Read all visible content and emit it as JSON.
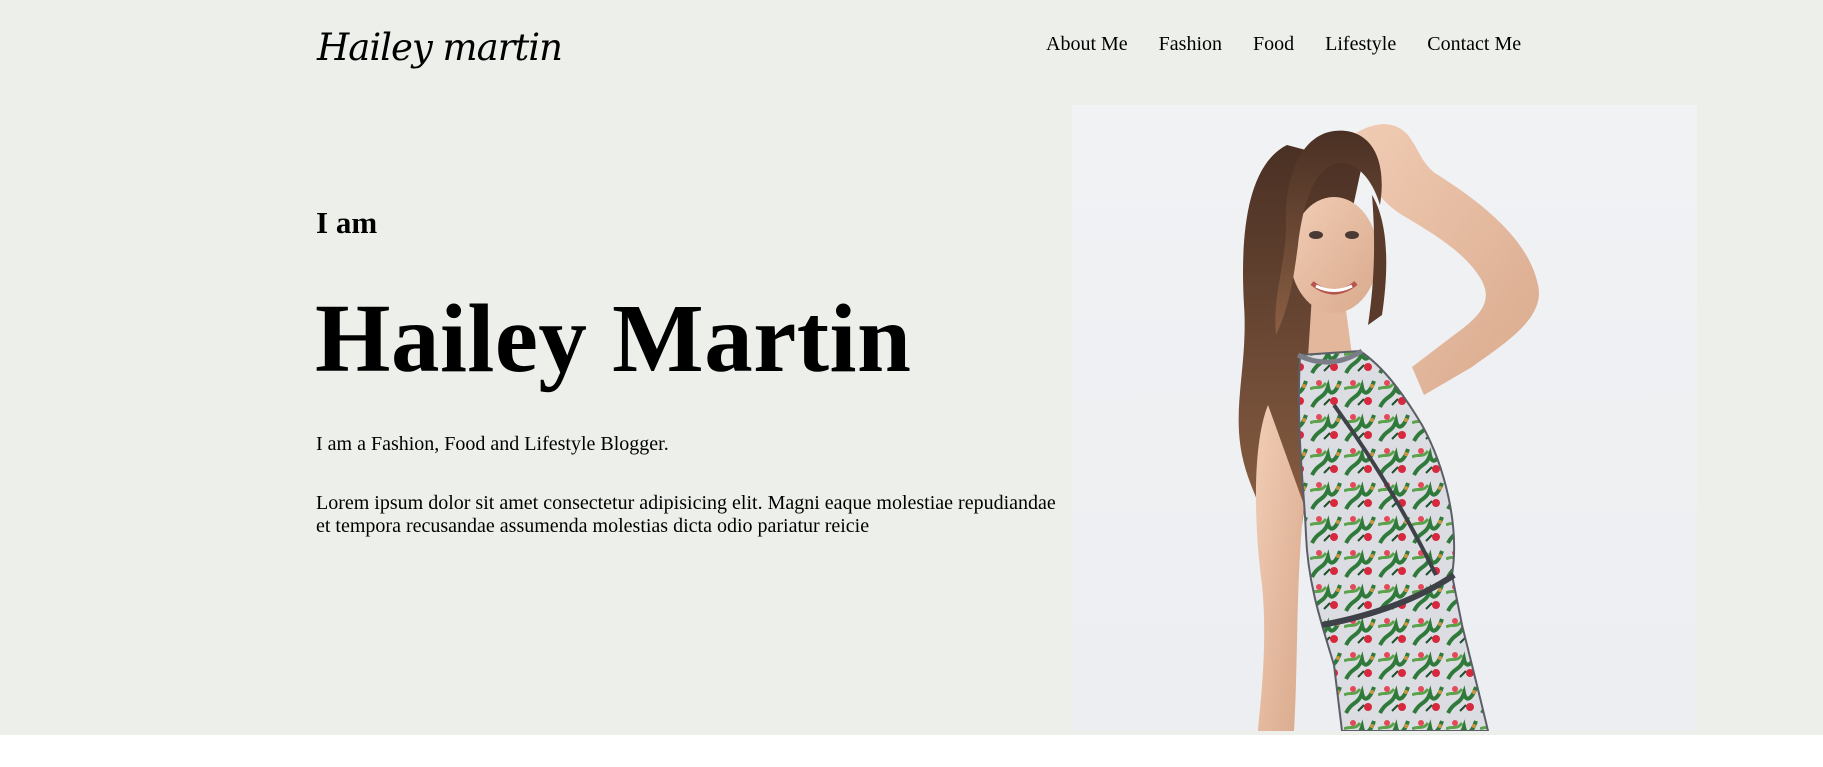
{
  "site": {
    "logo": "Hailey martin"
  },
  "nav": {
    "items": [
      "About Me",
      "Fashion",
      "Food",
      "Lifestyle",
      "Contact Me"
    ]
  },
  "hero": {
    "intro": "I am",
    "name": "Hailey Martin",
    "tagline": "I am a Fashion, Food and Lifestyle Blogger.",
    "description": "Lorem ipsum dolor sit amet consectetur adipisicing elit. Magni eaque molestiae repudiandae et tempora recusandae assumenda molestias dicta odio pariatur reicie"
  },
  "colors": {
    "hero_background": "#edf0ea",
    "photo_background": "#eff0f3",
    "text": "#000000"
  }
}
